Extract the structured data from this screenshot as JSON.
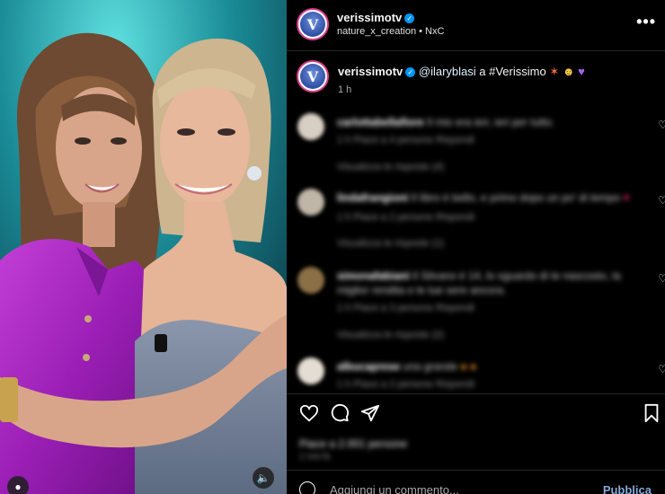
{
  "post": {
    "username": "verissimotv",
    "location": "nature_x_creation",
    "audio": "NxC",
    "caption_mention": "@ilaryblasi",
    "caption_text": " a #Verissimo ",
    "time": "1 h",
    "avatar_letter": "V"
  },
  "comments": [
    {
      "user": "carlottabellafiore",
      "text": "Il mio era ieri, ieri per tutto.",
      "meta": "1 h   Piace a 4 persone   Rispondi",
      "replies": "Visualizza le risposte (4)"
    },
    {
      "user": "lindafrangioni",
      "text": "Il libro è bello, e primo dopo un po' di tempo",
      "meta": "1 h   Piace a 2 persone   Rispondi",
      "replies": "Visualizza le risposte (1)"
    },
    {
      "user": "simonafabiani",
      "text": "Il Silvano è 14, lo sguardo di te nascosto, la miglior rendita e le tue sere ancora.",
      "meta": "1 h   Piace a 3 persone   Rispondi",
      "replies": "Visualizza le risposte (2)"
    },
    {
      "user": "albucaprese",
      "text": "una grande",
      "meta": "1 h   Piace a 2 persone   Rispondi",
      "replies": ""
    }
  ],
  "likes": "Piace a 2.001 persone",
  "date": "1 ora fa",
  "comment_placeholder": "Aggiungi un commento...",
  "publish_label": "Pubblica",
  "colors": {
    "accent": "#0095f6",
    "publish": "#85a8d6",
    "background": "#000000"
  }
}
